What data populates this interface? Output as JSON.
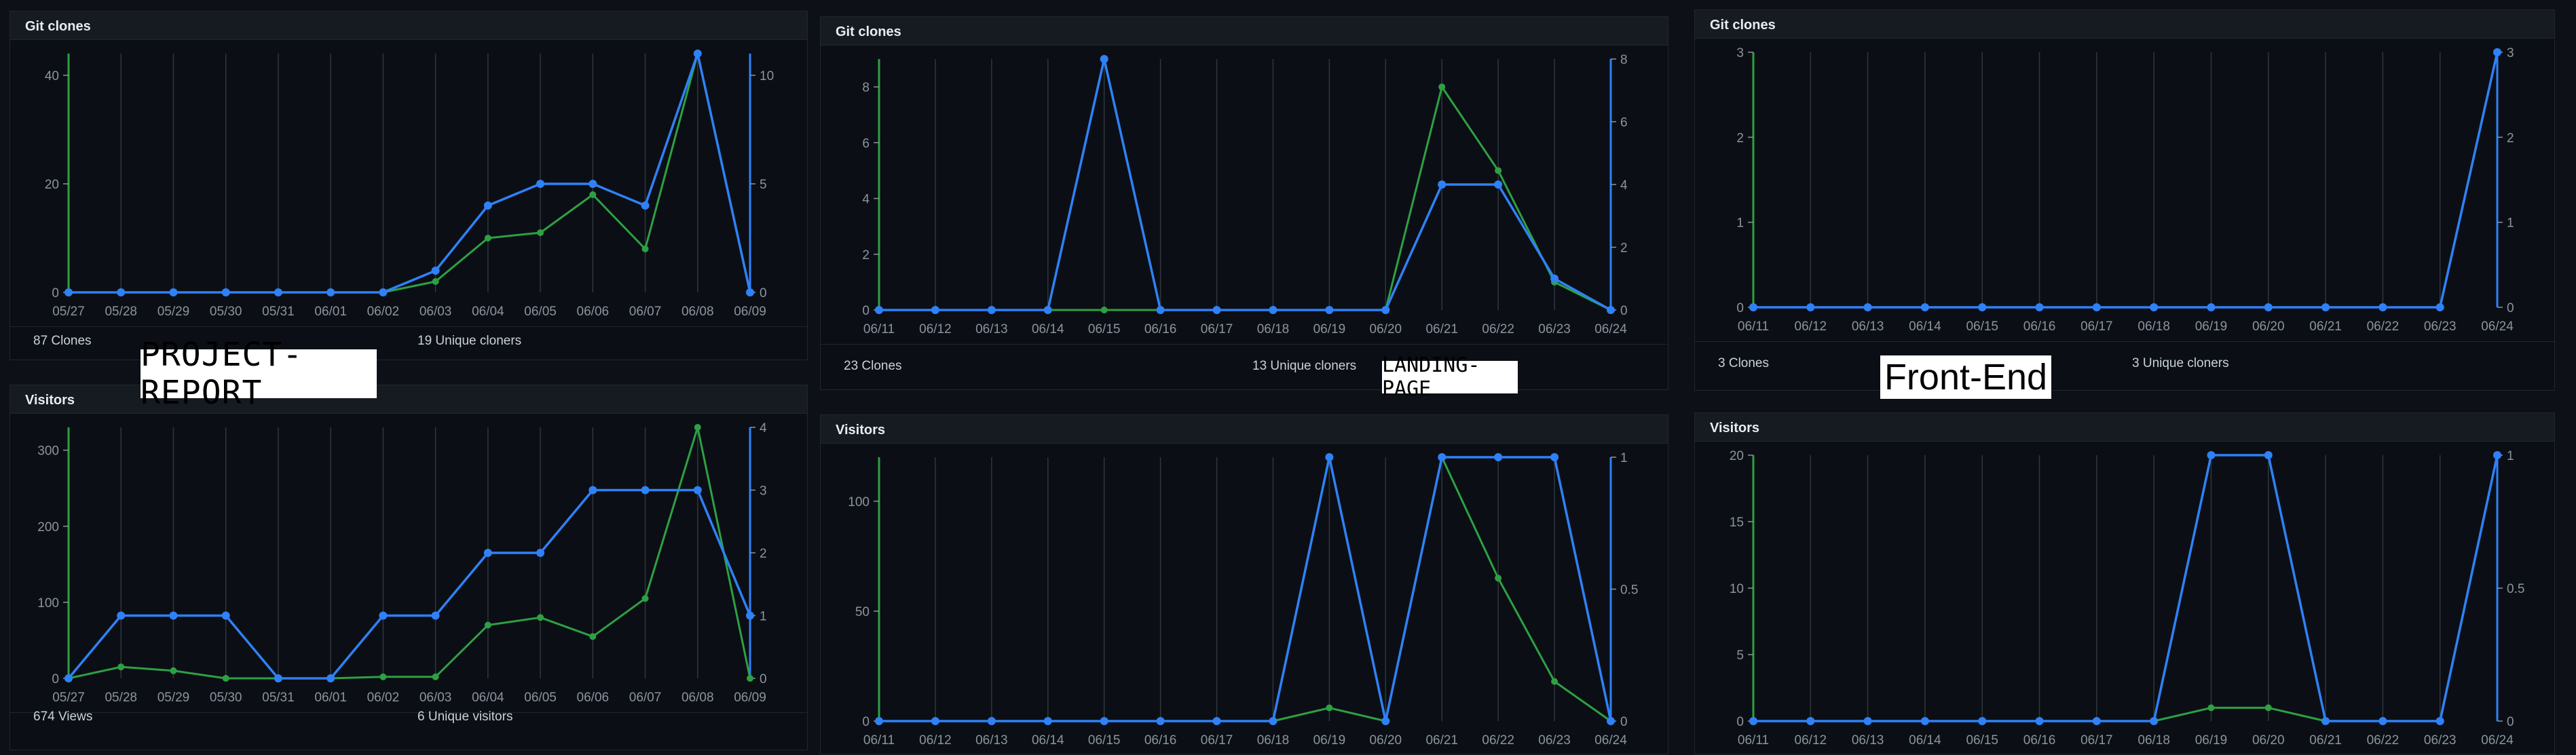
{
  "colors": {
    "page_background": "#0d1117",
    "panel_header": "#161b22",
    "total_series": "#2ea043",
    "unique_series": "#2f81f7",
    "gridline": "#30363d",
    "tick_text": "#8b949e"
  },
  "repo_labels": [
    "PROJECT-REPORT",
    "LANDING-PAGE",
    "Front-End"
  ],
  "panels": [
    {
      "title": "Git clones",
      "stats": {
        "total": "87 Clones",
        "unique": "19 Unique cloners"
      },
      "chart_data": {
        "type": "line",
        "categories": [
          "05/27",
          "05/28",
          "05/29",
          "05/30",
          "05/31",
          "06/01",
          "06/02",
          "06/03",
          "06/04",
          "06/05",
          "06/06",
          "06/07",
          "06/08",
          "06/09"
        ],
        "series": [
          {
            "values": [
              0,
              0,
              0,
              0,
              0,
              0,
              0,
              2,
              10,
              11,
              18,
              8,
              44,
              0
            ],
            "axis": "left",
            "color": "#2ea043"
          },
          {
            "values": [
              0,
              0,
              0,
              0,
              0,
              0,
              0,
              1,
              4,
              5,
              5,
              4,
              11,
              0
            ],
            "axis": "right",
            "color": "#2f81f7"
          }
        ],
        "left_ticks": [
          "0",
          "20",
          "40"
        ],
        "left_tick_values": [
          0,
          20,
          40
        ],
        "left_max": 44,
        "right_ticks": [
          "0",
          "5",
          "10"
        ],
        "right_tick_values": [
          0,
          5,
          10
        ],
        "right_max": 11,
        "grid": true
      }
    },
    {
      "title": "Visitors",
      "stats": {
        "total": "674 Views",
        "unique": "6 Unique visitors"
      },
      "chart_data": {
        "type": "line",
        "categories": [
          "05/27",
          "05/28",
          "05/29",
          "05/30",
          "05/31",
          "06/01",
          "06/02",
          "06/03",
          "06/04",
          "06/05",
          "06/06",
          "06/07",
          "06/08",
          "06/09"
        ],
        "series": [
          {
            "values": [
              0,
              15,
              10,
              0,
              0,
              0,
              2,
              2,
              70,
              80,
              55,
              105,
              330,
              0
            ],
            "axis": "left",
            "color": "#2ea043"
          },
          {
            "values": [
              0,
              1,
              1,
              1,
              0,
              0,
              1,
              1,
              2,
              2,
              3,
              3,
              3,
              1
            ],
            "axis": "right",
            "color": "#2f81f7"
          }
        ],
        "left_ticks": [
          "0",
          "100",
          "200",
          "300"
        ],
        "left_tick_values": [
          0,
          100,
          200,
          300
        ],
        "left_max": 330,
        "right_ticks": [
          "0",
          "1",
          "2",
          "3",
          "4"
        ],
        "right_tick_values": [
          0,
          1,
          2,
          3,
          4
        ],
        "right_max": 4,
        "grid": true
      }
    },
    {
      "title": "Git clones",
      "stats": {
        "total": "23 Clones",
        "unique": "13 Unique cloners"
      },
      "chart_data": {
        "type": "line",
        "categories": [
          "06/11",
          "06/12",
          "06/13",
          "06/14",
          "06/15",
          "06/16",
          "06/17",
          "06/18",
          "06/19",
          "06/20",
          "06/21",
          "06/22",
          "06/23",
          "06/24"
        ],
        "series": [
          {
            "values": [
              0,
              0,
              0,
              0,
              0,
              0,
              0,
              0,
              0,
              0,
              8,
              5,
              1,
              0
            ],
            "axis": "left",
            "color": "#2ea043"
          },
          {
            "values": [
              0,
              0,
              0,
              0,
              8,
              0,
              0,
              0,
              0,
              0,
              4,
              4,
              1,
              0
            ],
            "axis": "right",
            "color": "#2f81f7"
          }
        ],
        "left_ticks": [
          "0",
          "2",
          "4",
          "6",
          "8"
        ],
        "left_tick_values": [
          0,
          2,
          4,
          6,
          8
        ],
        "left_max": 9,
        "right_ticks": [
          "0",
          "2",
          "4",
          "6",
          "8"
        ],
        "right_tick_values": [
          0,
          2,
          4,
          6,
          8
        ],
        "right_max": 8,
        "grid": true
      }
    },
    {
      "title": "Visitors",
      "stats": {
        "total": "",
        "unique": ""
      },
      "chart_data": {
        "type": "line",
        "categories": [
          "06/11",
          "06/12",
          "06/13",
          "06/14",
          "06/15",
          "06/16",
          "06/17",
          "06/18",
          "06/19",
          "06/20",
          "06/21",
          "06/22",
          "06/23",
          "06/24"
        ],
        "series": [
          {
            "values": [
              0,
              0,
              0,
              0,
              0,
              0,
              0,
              0,
              6,
              0,
              120,
              65,
              18,
              0
            ],
            "axis": "left",
            "color": "#2ea043"
          },
          {
            "values": [
              0,
              0,
              0,
              0,
              0,
              0,
              0,
              0,
              1,
              0,
              1,
              1,
              1,
              0
            ],
            "axis": "right",
            "color": "#2f81f7"
          }
        ],
        "left_ticks": [
          "0",
          "50",
          "100"
        ],
        "left_tick_values": [
          0,
          50,
          100
        ],
        "left_max": 120,
        "right_ticks": [
          "0",
          "0.5",
          "1"
        ],
        "right_tick_values": [
          0,
          0.5,
          1
        ],
        "right_max": 1,
        "grid": true
      }
    },
    {
      "title": "Git clones",
      "stats": {
        "total": "3 Clones",
        "unique": "3 Unique cloners"
      },
      "chart_data": {
        "type": "line",
        "categories": [
          "06/11",
          "06/12",
          "06/13",
          "06/14",
          "06/15",
          "06/16",
          "06/17",
          "06/18",
          "06/19",
          "06/20",
          "06/21",
          "06/22",
          "06/23",
          "06/24"
        ],
        "series": [
          {
            "values": [
              0,
              0,
              0,
              0,
              0,
              0,
              0,
              0,
              0,
              0,
              0,
              0,
              0,
              3
            ],
            "axis": "left",
            "color": "#2ea043"
          },
          {
            "values": [
              0,
              0,
              0,
              0,
              0,
              0,
              0,
              0,
              0,
              0,
              0,
              0,
              0,
              3
            ],
            "axis": "right",
            "color": "#2f81f7"
          }
        ],
        "left_ticks": [
          "0",
          "1",
          "2",
          "3"
        ],
        "left_tick_values": [
          0,
          1,
          2,
          3
        ],
        "left_max": 3,
        "right_ticks": [
          "0",
          "1",
          "2",
          "3"
        ],
        "right_tick_values": [
          0,
          1,
          2,
          3
        ],
        "right_max": 3,
        "grid": true
      }
    },
    {
      "title": "Visitors",
      "stats": {
        "total": "",
        "unique": ""
      },
      "chart_data": {
        "type": "line",
        "categories": [
          "06/11",
          "06/12",
          "06/13",
          "06/14",
          "06/15",
          "06/16",
          "06/17",
          "06/18",
          "06/19",
          "06/20",
          "06/21",
          "06/22",
          "06/23",
          "06/24"
        ],
        "series": [
          {
            "values": [
              0,
              0,
              0,
              0,
              0,
              0,
              0,
              0,
              1,
              1,
              0,
              0,
              0,
              20
            ],
            "axis": "left",
            "color": "#2ea043"
          },
          {
            "values": [
              0,
              0,
              0,
              0,
              0,
              0,
              0,
              0,
              1,
              1,
              0,
              0,
              0,
              1
            ],
            "axis": "right",
            "color": "#2f81f7"
          }
        ],
        "left_ticks": [
          "0",
          "5",
          "10",
          "15",
          "20"
        ],
        "left_tick_values": [
          0,
          5,
          10,
          15,
          20
        ],
        "left_max": 20,
        "right_ticks": [
          "0",
          "0.5",
          "1"
        ],
        "right_tick_values": [
          0,
          0.5,
          1
        ],
        "right_max": 1,
        "grid": true
      }
    }
  ]
}
